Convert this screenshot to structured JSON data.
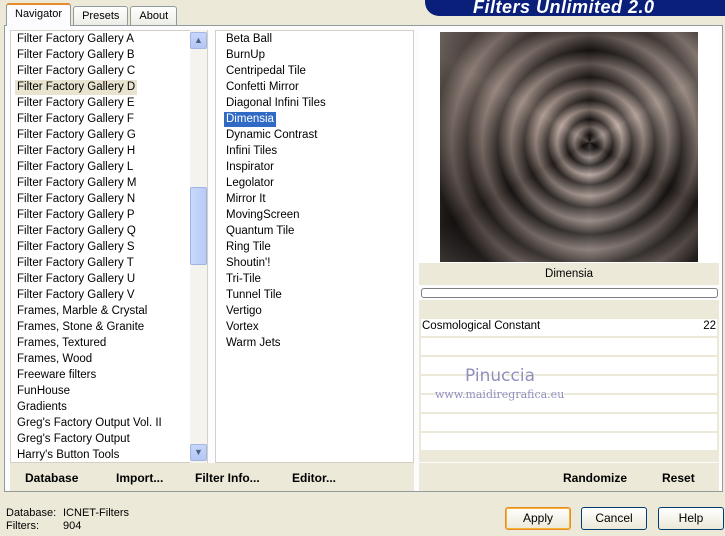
{
  "tabs": [
    "Navigator",
    "Presets",
    "About"
  ],
  "app_title": "Filters Unlimited 2.0",
  "categories": [
    "Filter Factory Gallery A",
    "Filter Factory Gallery B",
    "Filter Factory Gallery C",
    "Filter Factory Gallery D",
    "Filter Factory Gallery E",
    "Filter Factory Gallery F",
    "Filter Factory Gallery G",
    "Filter Factory Gallery H",
    "Filter Factory Gallery L",
    "Filter Factory Gallery M",
    "Filter Factory Gallery N",
    "Filter Factory Gallery P",
    "Filter Factory Gallery Q",
    "Filter Factory Gallery S",
    "Filter Factory Gallery T",
    "Filter Factory Gallery U",
    "Filter Factory Gallery V",
    "Frames, Marble & Crystal",
    "Frames, Stone & Granite",
    "Frames, Textured",
    "Frames, Wood",
    "Freeware filters",
    "FunHouse",
    "Gradients",
    "Greg's Factory Output Vol. II",
    "Greg's Factory Output",
    "Harry's Button Tools"
  ],
  "selected_category": "Filter Factory Gallery D",
  "filters": [
    "Beta Ball",
    "BurnUp",
    "Centripedal Tile",
    "Confetti Mirror",
    "Diagonal Infini Tiles",
    "Dimensia",
    "Dynamic Contrast",
    "Infini Tiles",
    "Inspirator",
    "Legolator",
    "Mirror It",
    "MovingScreen",
    "Quantum Tile",
    "Ring Tile",
    "Shoutin'!",
    "Tri-Tile",
    "Tunnel Tile",
    "Vertigo",
    "Vortex",
    "Warm Jets"
  ],
  "selected_filter": "Dimensia",
  "preview_filter_name": "Dimensia",
  "progress": 0,
  "parameters": [
    {
      "name": "Cosmological Constant",
      "value": "22"
    }
  ],
  "watermark": {
    "line1": "Pinuccia",
    "line2": "www.maidiregrafica.eu"
  },
  "left_buttons": [
    "Database",
    "Import...",
    "Filter Info...",
    "Editor..."
  ],
  "right_buttons": [
    "Randomize",
    "Reset"
  ],
  "status": {
    "database_label": "Database:",
    "database_value": "ICNET-Filters",
    "filters_label": "Filters:",
    "filters_value": "904"
  },
  "dialog_buttons": {
    "apply": "Apply",
    "cancel": "Cancel",
    "help": "Help"
  },
  "colors": {
    "selection": "#316ac5",
    "banner": "#0a1f7a",
    "dialog_bg": "#ece9d8"
  }
}
